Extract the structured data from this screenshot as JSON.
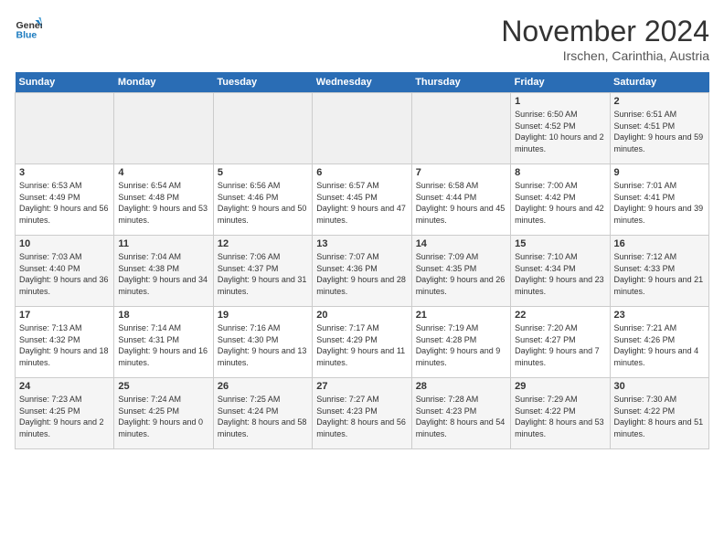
{
  "logo": {
    "line1": "General",
    "line2": "Blue"
  },
  "title": "November 2024",
  "subtitle": "Irschen, Carinthia, Austria",
  "days_header": [
    "Sunday",
    "Monday",
    "Tuesday",
    "Wednesday",
    "Thursday",
    "Friday",
    "Saturday"
  ],
  "weeks": [
    [
      {
        "day": "",
        "info": ""
      },
      {
        "day": "",
        "info": ""
      },
      {
        "day": "",
        "info": ""
      },
      {
        "day": "",
        "info": ""
      },
      {
        "day": "",
        "info": ""
      },
      {
        "day": "1",
        "info": "Sunrise: 6:50 AM\nSunset: 4:52 PM\nDaylight: 10 hours\nand 2 minutes."
      },
      {
        "day": "2",
        "info": "Sunrise: 6:51 AM\nSunset: 4:51 PM\nDaylight: 9 hours\nand 59 minutes."
      }
    ],
    [
      {
        "day": "3",
        "info": "Sunrise: 6:53 AM\nSunset: 4:49 PM\nDaylight: 9 hours\nand 56 minutes."
      },
      {
        "day": "4",
        "info": "Sunrise: 6:54 AM\nSunset: 4:48 PM\nDaylight: 9 hours\nand 53 minutes."
      },
      {
        "day": "5",
        "info": "Sunrise: 6:56 AM\nSunset: 4:46 PM\nDaylight: 9 hours\nand 50 minutes."
      },
      {
        "day": "6",
        "info": "Sunrise: 6:57 AM\nSunset: 4:45 PM\nDaylight: 9 hours\nand 47 minutes."
      },
      {
        "day": "7",
        "info": "Sunrise: 6:58 AM\nSunset: 4:44 PM\nDaylight: 9 hours\nand 45 minutes."
      },
      {
        "day": "8",
        "info": "Sunrise: 7:00 AM\nSunset: 4:42 PM\nDaylight: 9 hours\nand 42 minutes."
      },
      {
        "day": "9",
        "info": "Sunrise: 7:01 AM\nSunset: 4:41 PM\nDaylight: 9 hours\nand 39 minutes."
      }
    ],
    [
      {
        "day": "10",
        "info": "Sunrise: 7:03 AM\nSunset: 4:40 PM\nDaylight: 9 hours\nand 36 minutes."
      },
      {
        "day": "11",
        "info": "Sunrise: 7:04 AM\nSunset: 4:38 PM\nDaylight: 9 hours\nand 34 minutes."
      },
      {
        "day": "12",
        "info": "Sunrise: 7:06 AM\nSunset: 4:37 PM\nDaylight: 9 hours\nand 31 minutes."
      },
      {
        "day": "13",
        "info": "Sunrise: 7:07 AM\nSunset: 4:36 PM\nDaylight: 9 hours\nand 28 minutes."
      },
      {
        "day": "14",
        "info": "Sunrise: 7:09 AM\nSunset: 4:35 PM\nDaylight: 9 hours\nand 26 minutes."
      },
      {
        "day": "15",
        "info": "Sunrise: 7:10 AM\nSunset: 4:34 PM\nDaylight: 9 hours\nand 23 minutes."
      },
      {
        "day": "16",
        "info": "Sunrise: 7:12 AM\nSunset: 4:33 PM\nDaylight: 9 hours\nand 21 minutes."
      }
    ],
    [
      {
        "day": "17",
        "info": "Sunrise: 7:13 AM\nSunset: 4:32 PM\nDaylight: 9 hours\nand 18 minutes."
      },
      {
        "day": "18",
        "info": "Sunrise: 7:14 AM\nSunset: 4:31 PM\nDaylight: 9 hours\nand 16 minutes."
      },
      {
        "day": "19",
        "info": "Sunrise: 7:16 AM\nSunset: 4:30 PM\nDaylight: 9 hours\nand 13 minutes."
      },
      {
        "day": "20",
        "info": "Sunrise: 7:17 AM\nSunset: 4:29 PM\nDaylight: 9 hours\nand 11 minutes."
      },
      {
        "day": "21",
        "info": "Sunrise: 7:19 AM\nSunset: 4:28 PM\nDaylight: 9 hours\nand 9 minutes."
      },
      {
        "day": "22",
        "info": "Sunrise: 7:20 AM\nSunset: 4:27 PM\nDaylight: 9 hours\nand 7 minutes."
      },
      {
        "day": "23",
        "info": "Sunrise: 7:21 AM\nSunset: 4:26 PM\nDaylight: 9 hours\nand 4 minutes."
      }
    ],
    [
      {
        "day": "24",
        "info": "Sunrise: 7:23 AM\nSunset: 4:25 PM\nDaylight: 9 hours\nand 2 minutes."
      },
      {
        "day": "25",
        "info": "Sunrise: 7:24 AM\nSunset: 4:25 PM\nDaylight: 9 hours\nand 0 minutes."
      },
      {
        "day": "26",
        "info": "Sunrise: 7:25 AM\nSunset: 4:24 PM\nDaylight: 8 hours\nand 58 minutes."
      },
      {
        "day": "27",
        "info": "Sunrise: 7:27 AM\nSunset: 4:23 PM\nDaylight: 8 hours\nand 56 minutes."
      },
      {
        "day": "28",
        "info": "Sunrise: 7:28 AM\nSunset: 4:23 PM\nDaylight: 8 hours\nand 54 minutes."
      },
      {
        "day": "29",
        "info": "Sunrise: 7:29 AM\nSunset: 4:22 PM\nDaylight: 8 hours\nand 53 minutes."
      },
      {
        "day": "30",
        "info": "Sunrise: 7:30 AM\nSunset: 4:22 PM\nDaylight: 8 hours\nand 51 minutes."
      }
    ]
  ]
}
